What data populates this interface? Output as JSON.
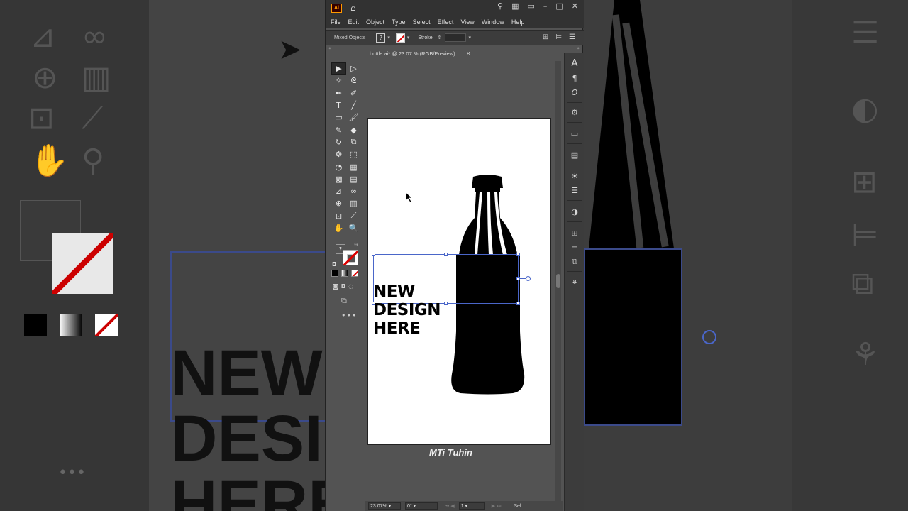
{
  "window": {
    "app_badge": "Ai",
    "minimize": "–",
    "maximize": "□",
    "close": "✕"
  },
  "menu": [
    "File",
    "Edit",
    "Object",
    "Type",
    "Select",
    "Effect",
    "View",
    "Window",
    "Help"
  ],
  "control_bar": {
    "selection_label": "Mixed Objects",
    "fill_value": "?",
    "stroke_label": "Stroke:",
    "stroke_weight": ""
  },
  "document_tab": {
    "title": "bottle.ai* @ 23.07 % (RGB/Preview)",
    "close": "×"
  },
  "tools": [
    {
      "icon": "selection-tool-icon",
      "glyph": "▶"
    },
    {
      "icon": "direct-selection-tool-icon",
      "glyph": "▷"
    },
    {
      "icon": "magic-wand-icon",
      "glyph": "✧"
    },
    {
      "icon": "lasso-icon",
      "glyph": "ᘓ"
    },
    {
      "icon": "pen-tool-icon",
      "glyph": "✒"
    },
    {
      "icon": "curvature-tool-icon",
      "glyph": "✐"
    },
    {
      "icon": "type-tool-icon",
      "glyph": "T"
    },
    {
      "icon": "line-tool-icon",
      "glyph": "╱"
    },
    {
      "icon": "rectangle-tool-icon",
      "glyph": "▭"
    },
    {
      "icon": "paintbrush-icon",
      "glyph": "🖌"
    },
    {
      "icon": "shaper-tool-icon",
      "glyph": "✎"
    },
    {
      "icon": "eraser-icon",
      "glyph": "◆"
    },
    {
      "icon": "rotate-tool-icon",
      "glyph": "↻"
    },
    {
      "icon": "scale-tool-icon",
      "glyph": "⧉"
    },
    {
      "icon": "warp-tool-icon",
      "glyph": "☸"
    },
    {
      "icon": "free-transform-icon",
      "glyph": "⬚"
    },
    {
      "icon": "shape-builder-icon",
      "glyph": "◔"
    },
    {
      "icon": "perspective-grid-icon",
      "glyph": "▦"
    },
    {
      "icon": "mesh-tool-icon",
      "glyph": "▩"
    },
    {
      "icon": "gradient-tool-icon",
      "glyph": "▤"
    },
    {
      "icon": "eyedropper-icon",
      "glyph": "⊿"
    },
    {
      "icon": "blend-tool-icon",
      "glyph": "∞"
    },
    {
      "icon": "symbol-sprayer-icon",
      "glyph": "⊕"
    },
    {
      "icon": "column-graph-icon",
      "glyph": "▥"
    },
    {
      "icon": "artboard-tool-icon",
      "glyph": "⊡"
    },
    {
      "icon": "slice-tool-icon",
      "glyph": "⟋"
    },
    {
      "icon": "hand-tool-icon",
      "glyph": "✋"
    },
    {
      "icon": "zoom-tool-icon",
      "glyph": "🔍"
    }
  ],
  "swatches": {
    "fill_indicator": "?",
    "more_tools": "•••"
  },
  "artwork": {
    "text_lines": [
      "NEW",
      "DESIGN",
      "HERE"
    ]
  },
  "watermark": "MTi Tuhin",
  "status_bar": {
    "zoom": "23.07%",
    "rotation": "0°",
    "artboard_number": "1",
    "status_label": "Sel"
  },
  "dock_icons": [
    "character-panel-icon",
    "paragraph-panel-icon",
    "opentype-panel-icon",
    "color-guide-icon",
    "gradient-panel-icon",
    "transparency-panel-icon",
    "appearance-panel-icon",
    "stroke-panel-icon",
    "pathfinder-panel-icon",
    "transform-panel-icon",
    "align-panel-icon",
    "layers-panel-icon",
    "libraries-panel-icon"
  ],
  "background_blur": {
    "text": "NEW"
  }
}
